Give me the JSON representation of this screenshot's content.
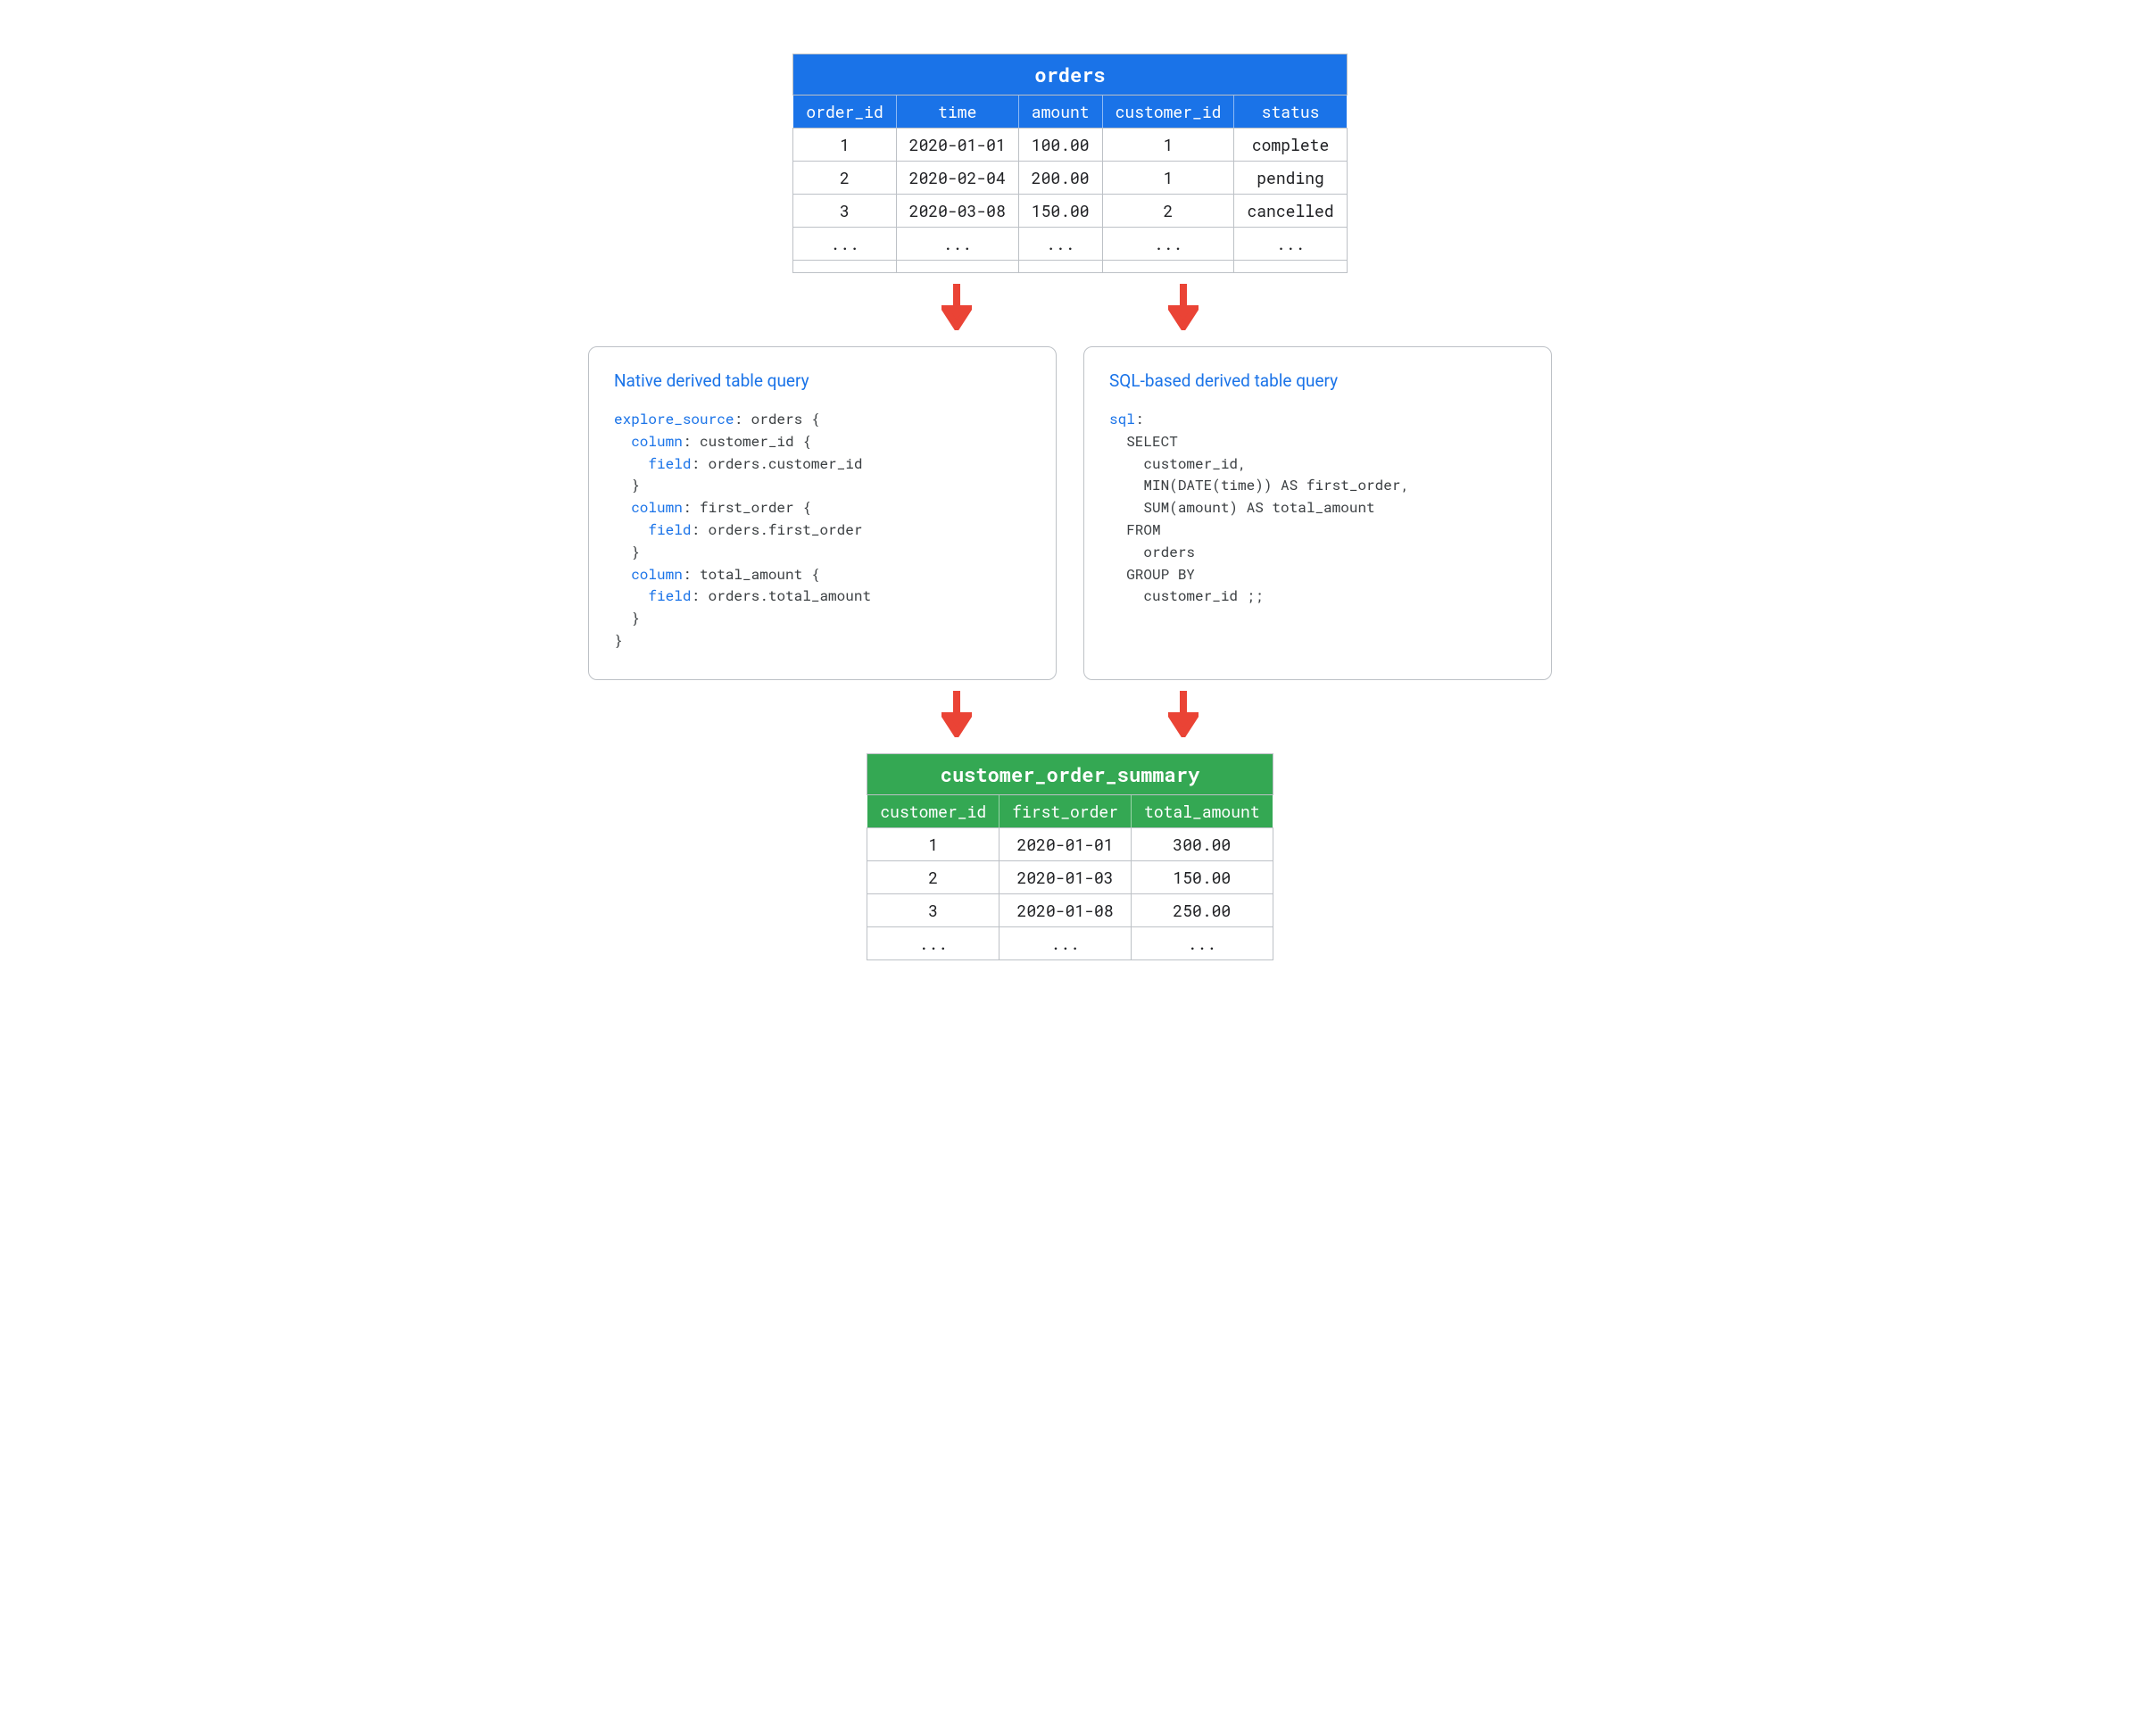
{
  "orders_table": {
    "title": "orders",
    "columns": [
      "order_id",
      "time",
      "amount",
      "customer_id",
      "status"
    ],
    "rows": [
      [
        "1",
        "2020-01-01",
        "100.00",
        "1",
        "complete"
      ],
      [
        "2",
        "2020-02-04",
        "200.00",
        "1",
        "pending"
      ],
      [
        "3",
        "2020-03-08",
        "150.00",
        "2",
        "cancelled"
      ],
      [
        "...",
        "...",
        "...",
        "...",
        "..."
      ]
    ]
  },
  "native_panel": {
    "title": "Native derived table query",
    "code_tokens": [
      {
        "t": "explore_source",
        "kw": true
      },
      {
        "t": ": orders {\n"
      },
      {
        "t": "  "
      },
      {
        "t": "column",
        "kw": true
      },
      {
        "t": ": customer_id {\n"
      },
      {
        "t": "    "
      },
      {
        "t": "field",
        "kw": true
      },
      {
        "t": ": orders.customer_id\n"
      },
      {
        "t": "  }\n"
      },
      {
        "t": "  "
      },
      {
        "t": "column",
        "kw": true
      },
      {
        "t": ": first_order {\n"
      },
      {
        "t": "    "
      },
      {
        "t": "field",
        "kw": true
      },
      {
        "t": ": orders.first_order\n"
      },
      {
        "t": "  }\n"
      },
      {
        "t": "  "
      },
      {
        "t": "column",
        "kw": true
      },
      {
        "t": ": total_amount {\n"
      },
      {
        "t": "    "
      },
      {
        "t": "field",
        "kw": true
      },
      {
        "t": ": orders.total_amount\n"
      },
      {
        "t": "  }\n"
      },
      {
        "t": "}"
      }
    ]
  },
  "sql_panel": {
    "title": "SQL-based derived table query",
    "code_tokens": [
      {
        "t": "sql",
        "kw": true
      },
      {
        "t": ":\n"
      },
      {
        "t": "  SELECT\n"
      },
      {
        "t": "    customer_id,\n"
      },
      {
        "t": "    MIN(DATE(time)) AS first_order,\n"
      },
      {
        "t": "    SUM(amount) AS total_amount\n"
      },
      {
        "t": "  FROM\n"
      },
      {
        "t": "    orders\n"
      },
      {
        "t": "  GROUP BY\n"
      },
      {
        "t": "    customer_id ;;"
      }
    ]
  },
  "summary_table": {
    "title": "customer_order_summary",
    "columns": [
      "customer_id",
      "first_order",
      "total_amount"
    ],
    "rows": [
      [
        "1",
        "2020-01-01",
        "300.00"
      ],
      [
        "2",
        "2020-01-03",
        "150.00"
      ],
      [
        "3",
        "2020-01-08",
        "250.00"
      ],
      [
        "...",
        "...",
        "..."
      ]
    ]
  },
  "colors": {
    "blue": "#1a73e8",
    "green": "#34a853",
    "arrow": "#ea4335"
  }
}
